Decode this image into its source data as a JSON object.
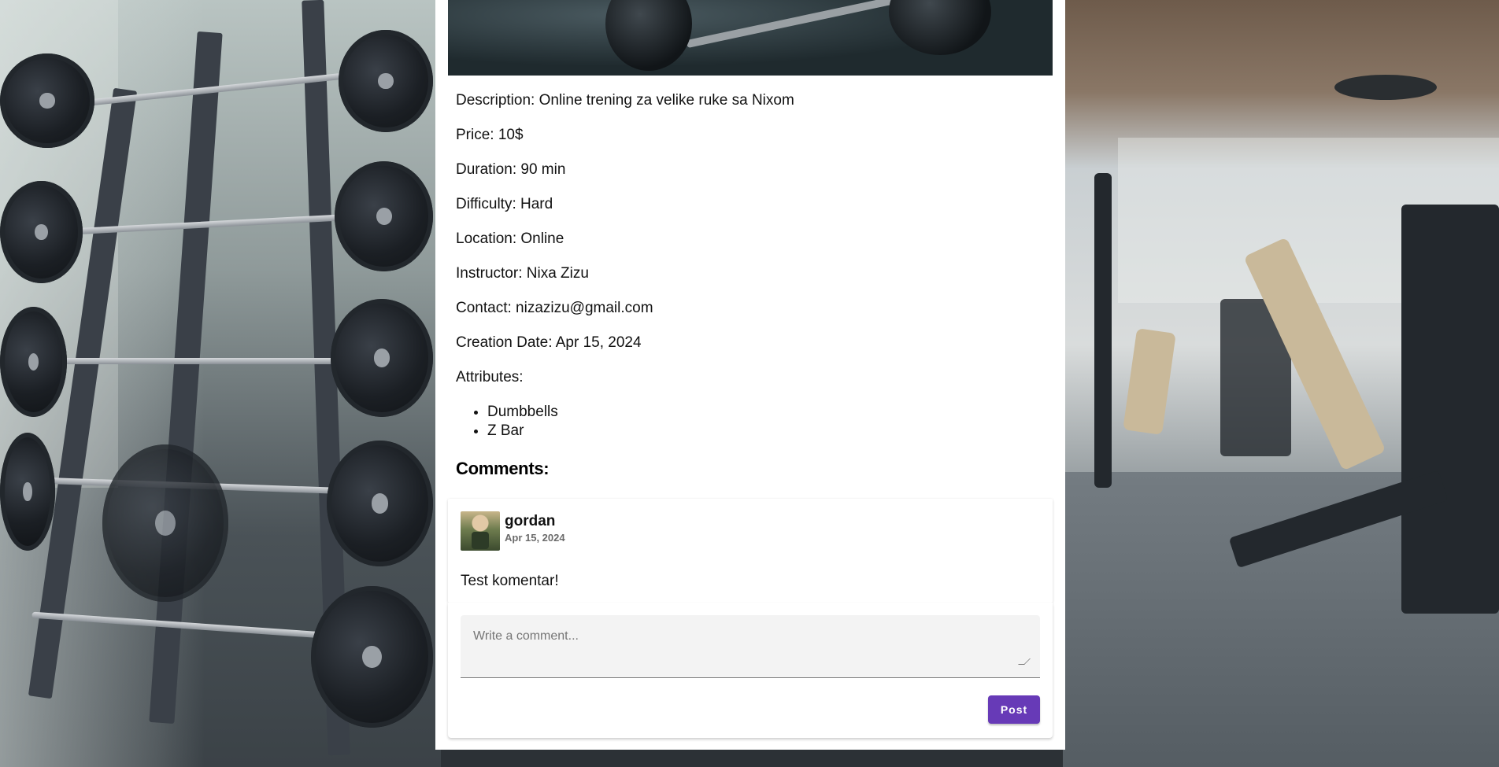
{
  "training": {
    "description": "Description: Online trening za velike ruke sa Nixom",
    "price": "Price: 10$",
    "duration": "Duration: 90 min",
    "difficulty": "Difficulty: Hard",
    "location": "Location: Online",
    "instructor": "Instructor: Nixa Zizu",
    "contact": "Contact: nizazizu@gmail.com",
    "creation_date": "Creation Date: Apr 15, 2024",
    "attributes_label": "Attributes:",
    "attributes": [
      "Dumbbells",
      "Z Bar"
    ]
  },
  "comments": {
    "heading": "Comments:",
    "items": [
      {
        "user": "gordan",
        "date": "Apr 15, 2024",
        "text": "Test komentar!"
      }
    ]
  },
  "compose": {
    "placeholder": "Write a comment...",
    "post_label": "Post"
  },
  "colors": {
    "primary": "#673ab7",
    "card": "#ffffff"
  }
}
